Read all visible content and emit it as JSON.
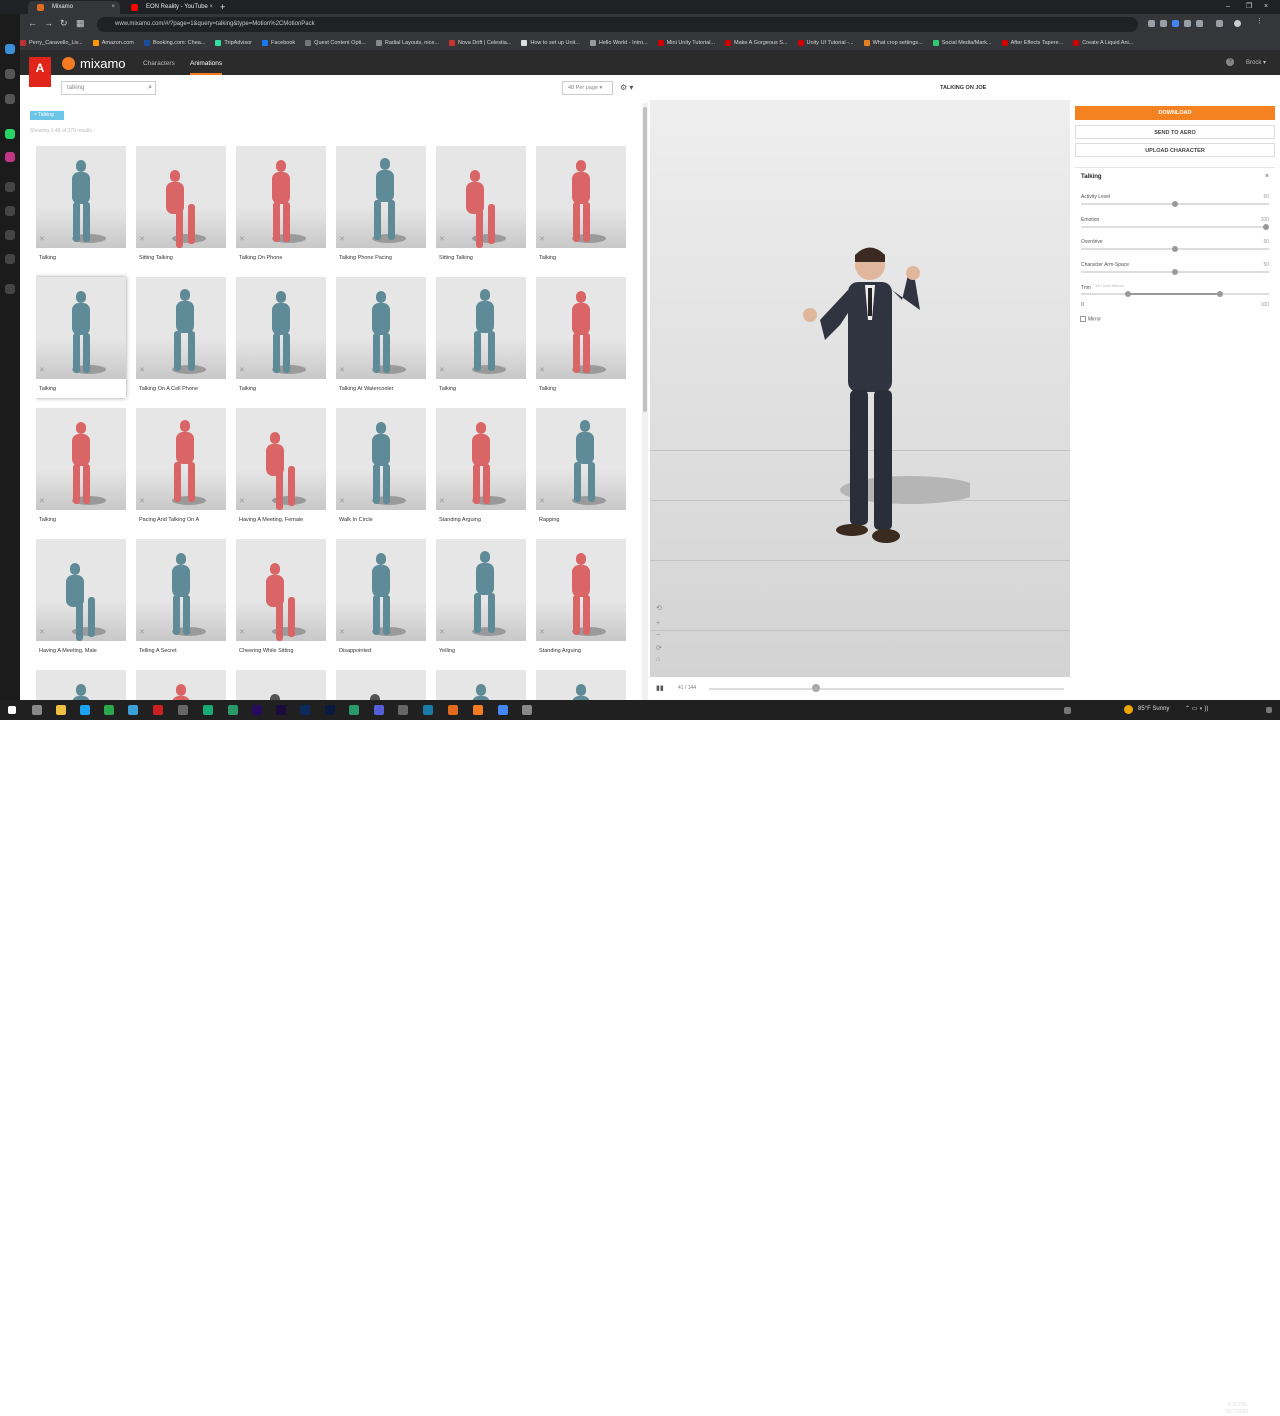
{
  "browser": {
    "tabs": [
      {
        "label": "Mixamo",
        "close": "×",
        "icon_color": "#e06b1f"
      },
      {
        "label": "EON Reality - YouTube",
        "close": "×",
        "icon_color": "#ff0000"
      }
    ],
    "new_tab": "+",
    "url": "www.mixamo.com/#/?page=1&query=talking&type=Motion%2CMotionPack",
    "nav_icons": [
      "back-icon",
      "forward-icon",
      "reload-icon",
      "apps-icon"
    ],
    "window_controls": [
      "–",
      "❐",
      "×"
    ],
    "bookmarks": [
      {
        "label": "Perry_Caravello_Liv...",
        "color": "#b33"
      },
      {
        "label": "Amazon.com",
        "color": "#ff9900"
      },
      {
        "label": "Booking.com: Chea...",
        "color": "#1a4fa0"
      },
      {
        "label": "TripAdvisor",
        "color": "#34e0a1"
      },
      {
        "label": "Facebook",
        "color": "#1877f2"
      },
      {
        "label": "Quest Content Opti...",
        "color": "#777"
      },
      {
        "label": "Radial Layouts, nice...",
        "color": "#888"
      },
      {
        "label": "Nova Drift | Celestia...",
        "color": "#c33"
      },
      {
        "label": "How to set up Unit...",
        "color": "#ddd"
      },
      {
        "label": "Hello World - Intro...",
        "color": "#999"
      },
      {
        "label": "Mini Unity Tutorial...",
        "color": "#c00"
      },
      {
        "label": "Make A Gorgeous S...",
        "color": "#c00"
      },
      {
        "label": "Unity UI Tutorial -...",
        "color": "#c00"
      },
      {
        "label": "What crop settings...",
        "color": "#e67e22"
      },
      {
        "label": "Social Media/Mark...",
        "color": "#2ecc71"
      },
      {
        "label": "After Effects Tapere...",
        "color": "#c00"
      },
      {
        "label": "Create A Liquid Ani...",
        "color": "#c00"
      }
    ]
  },
  "mixamo": {
    "adobe": "A",
    "brand": "mixamo",
    "nav": [
      "Characters",
      "Animations"
    ],
    "help": "?",
    "user": "Brock ▾",
    "search_value": "talking",
    "per_page": "48 Per page ▾",
    "gear": "⚙ ▾",
    "chip": "× Talking",
    "result_count": "Showing 1-48 of 379 results",
    "cards": [
      {
        "label": "Talking",
        "color": "#5f8a98",
        "pose": 0
      },
      {
        "label": "Sitting Talking",
        "color": "#d96566",
        "pose": 1
      },
      {
        "label": "Talking On Phone",
        "color": "#d96566",
        "pose": 0
      },
      {
        "label": "Talking Phone Pacing",
        "color": "#5f8a98",
        "pose": 2
      },
      {
        "label": "Sitting Talking",
        "color": "#d96566",
        "pose": 1
      },
      {
        "label": "Talking",
        "color": "#d96566",
        "pose": 0
      },
      {
        "label": "Talking",
        "color": "#5f8a98",
        "pose": 0
      },
      {
        "label": "Talking On A Cell Phone",
        "color": "#5f8a98",
        "pose": 2
      },
      {
        "label": "Talking",
        "color": "#5f8a98",
        "pose": 0
      },
      {
        "label": "Talking At Watercooler",
        "color": "#5f8a98",
        "pose": 0
      },
      {
        "label": "Talking",
        "color": "#5f8a98",
        "pose": 2
      },
      {
        "label": "Talking",
        "color": "#d96566",
        "pose": 0
      },
      {
        "label": "Talking",
        "color": "#d96566",
        "pose": 0
      },
      {
        "label": "Pacing And Talking On A",
        "color": "#d96566",
        "pose": 2
      },
      {
        "label": "Having A Meeting, Female",
        "color": "#d96566",
        "pose": 1
      },
      {
        "label": "Walk In Circle",
        "color": "#5f8a98",
        "pose": 0
      },
      {
        "label": "Standing Arguing",
        "color": "#d96566",
        "pose": 0
      },
      {
        "label": "Rapping",
        "color": "#5f8a98",
        "pose": 2
      },
      {
        "label": "Having A Meeting, Male",
        "color": "#5f8a98",
        "pose": 1
      },
      {
        "label": "Telling A Secret",
        "color": "#5f8a98",
        "pose": 0
      },
      {
        "label": "Cheering While Sitting",
        "color": "#d96566",
        "pose": 1
      },
      {
        "label": "Disappointed",
        "color": "#5f8a98",
        "pose": 0
      },
      {
        "label": "Yelling",
        "color": "#5f8a98",
        "pose": 2
      },
      {
        "label": "Standing Arguing",
        "color": "#d96566",
        "pose": 0
      },
      {
        "label": "",
        "color": "#5f8a98",
        "pose": 0
      },
      {
        "label": "",
        "color": "#d96566",
        "pose": 0
      },
      {
        "label": "",
        "color": "#555555",
        "pose": 1
      },
      {
        "label": "",
        "color": "#555555",
        "pose": 1
      },
      {
        "label": "",
        "color": "#5f8a98",
        "pose": 0
      },
      {
        "label": "",
        "color": "#5f8a98",
        "pose": 0
      }
    ],
    "selected_card": 6,
    "viewer_title": "TALKING ON JOE",
    "frame_counter": "41 / 144",
    "play": "▮▮",
    "scrub_fraction": 0.29,
    "view_tools": [
      "⟲",
      "+",
      "−",
      "⟳",
      "⌂"
    ],
    "download": "DOWNLOAD",
    "send_to_aero": "SEND TO AERO",
    "upload_character": "UPLOAD CHARACTER",
    "panel_title": "Talking",
    "panel_close": "×",
    "sliders": [
      {
        "label": "Activity Level",
        "value": "50",
        "fraction": 0.5
      },
      {
        "label": "Emotion",
        "value": "100",
        "fraction": 1.0
      },
      {
        "label": "Overdrive",
        "value": "50",
        "fraction": 0.5
      },
      {
        "label": "Character Arm-Space",
        "value": "50",
        "fraction": 0.5
      }
    ],
    "trim_label": "Trim",
    "trim_hint": "140 total frames",
    "trim_min": "0",
    "trim_max": "100",
    "mirror": "Mirror",
    "accent": "#f58220"
  },
  "taskbar": {
    "weather": "85°F Sunny",
    "time": "6:30 PM",
    "date": "8/27/2022"
  }
}
